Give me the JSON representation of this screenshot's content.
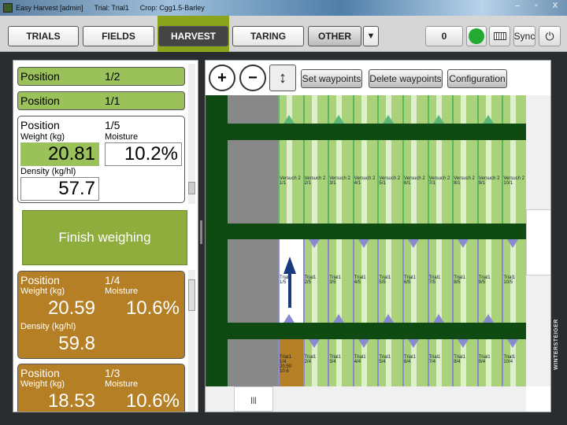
{
  "window": {
    "app": "Easy Harvest [admin]",
    "trial": "Trial: Trial1",
    "crop": "Crop: Cgg1.5-Barley",
    "min": "–",
    "max": "▫",
    "close": "X"
  },
  "nav": {
    "tabs": [
      "TRIALS",
      "FIELDS",
      "HARVEST",
      "TARING",
      "OTHER"
    ],
    "active": "HARVEST",
    "counter": "0",
    "sync": "Sync",
    "status_color": "#22aa33",
    "icons": [
      "dropdown-icon",
      "keyboard-icon",
      "power-icon"
    ]
  },
  "positions": {
    "done": [
      {
        "label": "Position",
        "value": "1/2"
      },
      {
        "label": "Position",
        "value": "1/1"
      }
    ],
    "current": {
      "label": "Position",
      "value": "1/5",
      "weight_label": "Weight (kg)",
      "weight": "20.81",
      "moisture_label": "Moisture",
      "moisture": "10.2%",
      "density_label": "Density (kg/hl)",
      "density": "57.7"
    },
    "finish_label": "Finish weighing",
    "history": [
      {
        "label": "Position",
        "value": "1/4",
        "weight_label": "Weight (kg)",
        "weight": "20.59",
        "moisture_label": "Moisture",
        "moisture": "10.6%",
        "density_label": "Density (kg/hl)",
        "density": "59.8"
      },
      {
        "label": "Position",
        "value": "1/3",
        "weight_label": "Weight (kg)",
        "weight": "18.53",
        "moisture_label": "Moisture",
        "moisture": "10.6%"
      }
    ]
  },
  "map": {
    "buttons": [
      "Set waypoints",
      "Delete waypoints",
      "Configuration"
    ],
    "rows": [
      {
        "prefix": "Versuch 2",
        "row": "1",
        "labels": [
          "1/1",
          "2/1",
          "3/1",
          "4/1",
          "5/1",
          "6/1",
          "7/1",
          "8/1",
          "9/1",
          "10/1"
        ]
      },
      {
        "prefix": "Trial1",
        "row": "5",
        "labels": [
          "1/5",
          "2/5",
          "3/5",
          "4/5",
          "5/5",
          "6/5",
          "7/5",
          "8/5",
          "9/5",
          "10/5"
        ]
      },
      {
        "prefix": "Trial1",
        "row": "4",
        "labels": [
          "1/4\n20.59\n10.6",
          "2/4",
          "3/4",
          "4/4",
          "5/4",
          "6/4",
          "7/4",
          "8/4",
          "9/4",
          "10/4"
        ]
      }
    ],
    "colors": {
      "plot": "#a9d27a",
      "road": "#0f4a12",
      "harvested": "#b57f25",
      "selected": "#ffffff",
      "arrow_up": "#5cb87a",
      "arrow_down": "#8a8ad0"
    }
  },
  "brand": "WINTERSTEIGER"
}
